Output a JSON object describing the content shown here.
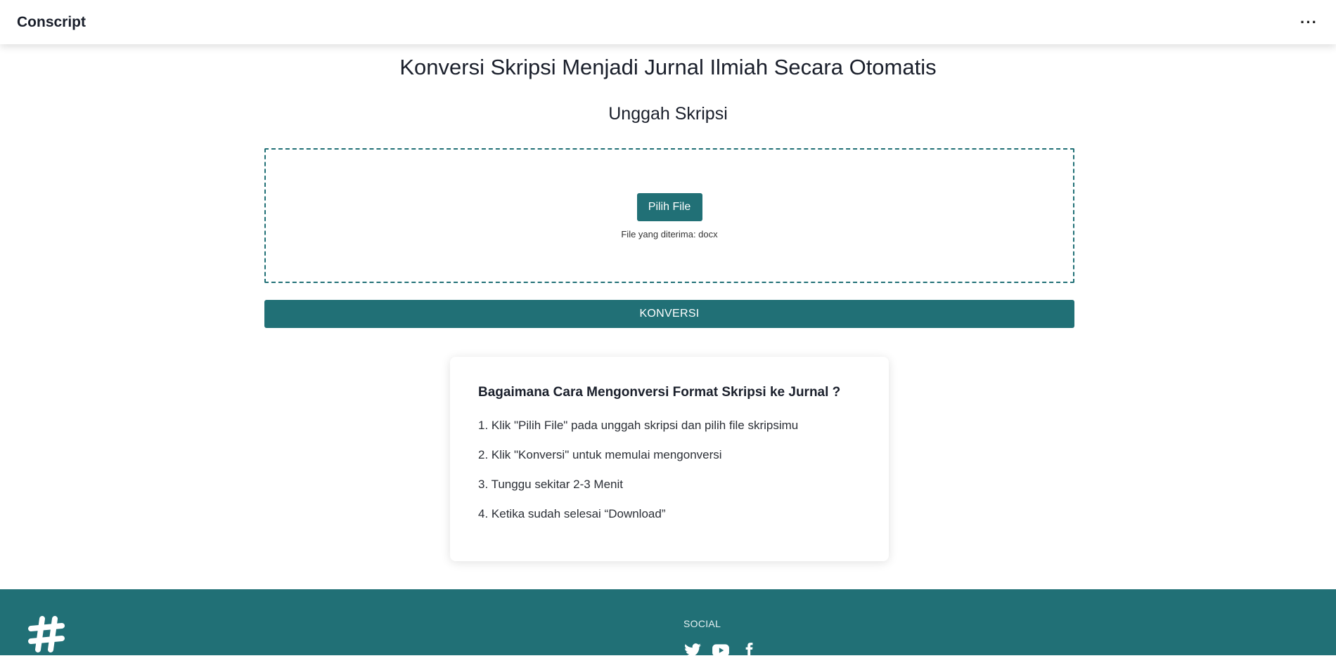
{
  "header": {
    "brand": "Conscript",
    "menu_icon": "more-horizontal-icon"
  },
  "main": {
    "title": "Konversi Skripsi Menjadi Jurnal Ilmiah Secara Otomatis",
    "upload_heading": "Unggah Skripsi",
    "file_button_label": "Pilih File",
    "accepted_note": "File yang diterima: docx",
    "convert_button_label": "KONVERSI"
  },
  "howto": {
    "title": "Bagaimana Cara Mengonversi Format Skripsi ke Jurnal ?",
    "steps": [
      "1. Klik \"Pilih File\" pada unggah skripsi dan pilih file skripsimu",
      "2. Klik \"Konversi\" untuk memulai mengonversi",
      "3. Tunggu sekitar 2-3 Menit",
      "4. Ketika sudah selesai “Download”"
    ]
  },
  "footer": {
    "logo_icon": "hashtag-icon",
    "social_heading": "SOCIAL",
    "social_icons": [
      "twitter-icon",
      "youtube-icon",
      "facebook-icon"
    ]
  },
  "colors": {
    "accent": "#217076",
    "text": "#1a1f2b",
    "background": "#ffffff"
  }
}
